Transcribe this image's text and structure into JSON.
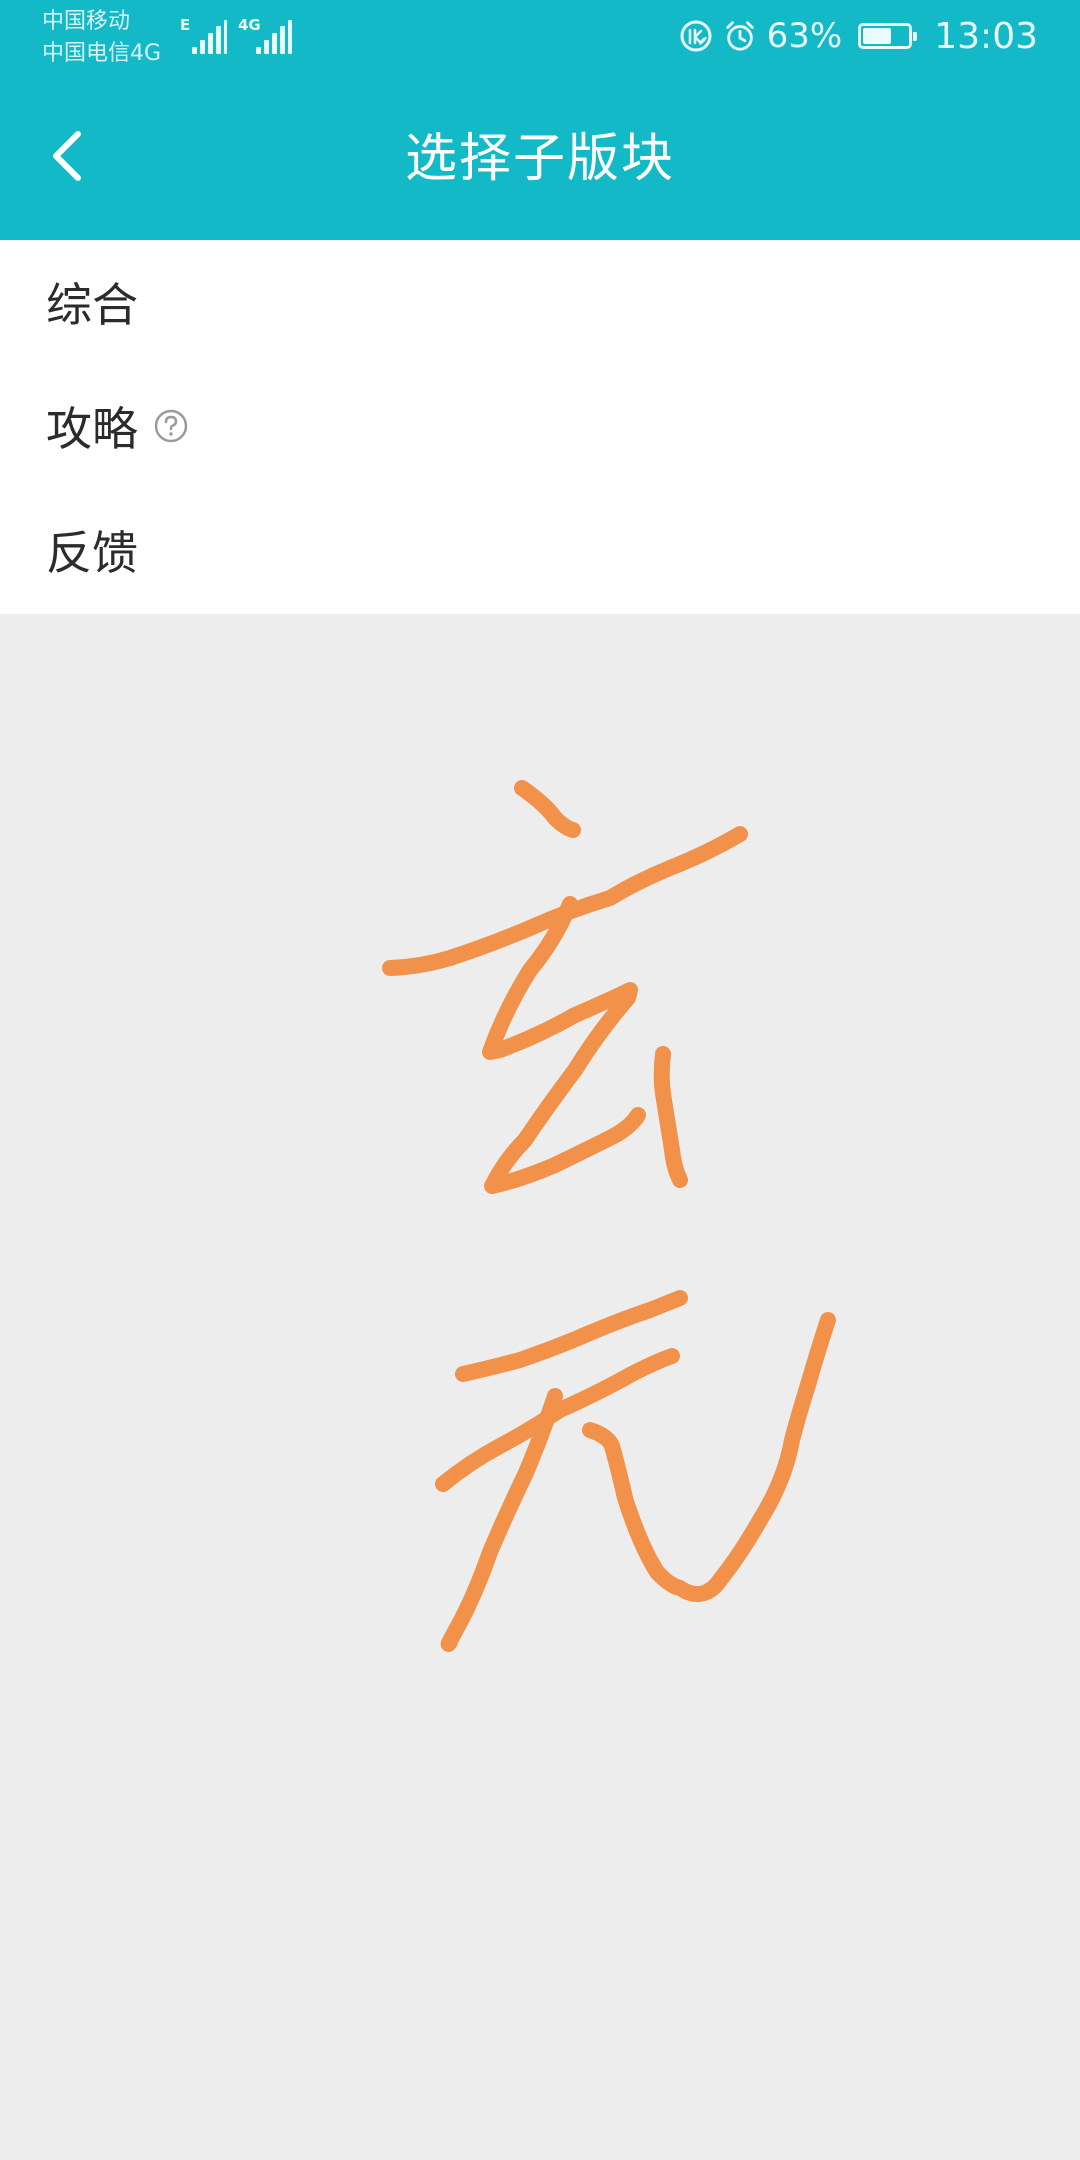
{
  "status_bar": {
    "carrier_1": "中国移动",
    "carrier_2": "中国电信4G",
    "signal_1_label": "E",
    "signal_2_label": "4G",
    "battery_percent": "63%",
    "battery_level": 0.63,
    "time": "13:03",
    "icons": [
      "data-saver-icon",
      "alarm-icon",
      "battery-icon"
    ]
  },
  "header": {
    "title": "选择子版块",
    "back_icon": "chevron-left-icon"
  },
  "sections": [
    {
      "label": "综合"
    },
    {
      "label": "攻略",
      "icon": "help-circle-icon"
    },
    {
      "label": "反馈"
    }
  ],
  "colors": {
    "header_bg": "#14b9c8",
    "list_bg": "#ffffff",
    "page_bg": "#ededed",
    "drawing_stroke": "#f2914a"
  }
}
